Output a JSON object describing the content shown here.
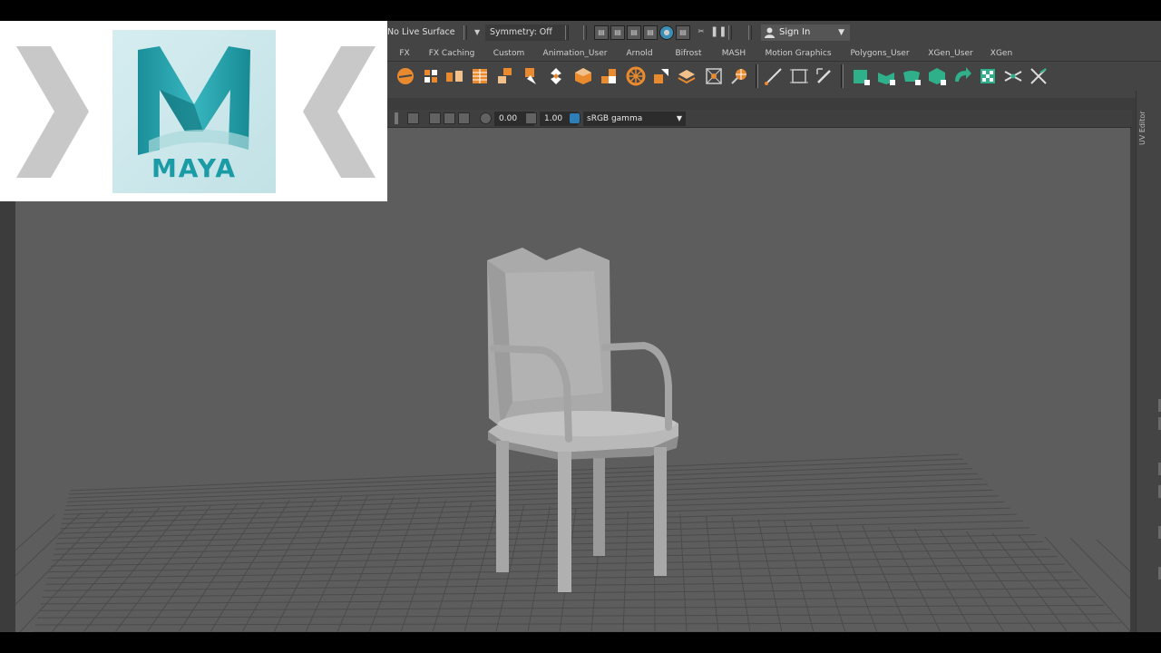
{
  "logo": {
    "product_name": "MAYA",
    "brand_color": "#1a9ba5",
    "icons": [
      "chevron-right-icon",
      "maya-logo-icon",
      "chevron-left-icon"
    ]
  },
  "status_line": {
    "live_surface": "No Live Surface",
    "symmetry": "Symmetry: Off",
    "sign_in": "Sign In",
    "render_icons": [
      "render-frame-icon",
      "render-sequence-icon",
      "ipr-render-icon",
      "render-settings-icon",
      "hypershade-icon",
      "render-view-icon",
      "toggle-icon",
      "pause-icon"
    ]
  },
  "shelf": {
    "tabs": [
      "FX",
      "FX Caching",
      "Custom",
      "Animation_User",
      "Arnold",
      "Bifrost",
      "MASH",
      "Motion Graphics",
      "Polygons_User",
      "XGen_User",
      "XGen"
    ],
    "accent_orange": "#e88a2d",
    "accent_green": "#2fb08a"
  },
  "panel_toolbar": {
    "exposure": "0.00",
    "gamma": "1.00",
    "color_space": "sRGB gamma"
  },
  "right_panel": {
    "uv_editor_label": "UV Editor"
  },
  "viewport": {
    "scene_object": "chair",
    "background": "#5d5d5d"
  }
}
